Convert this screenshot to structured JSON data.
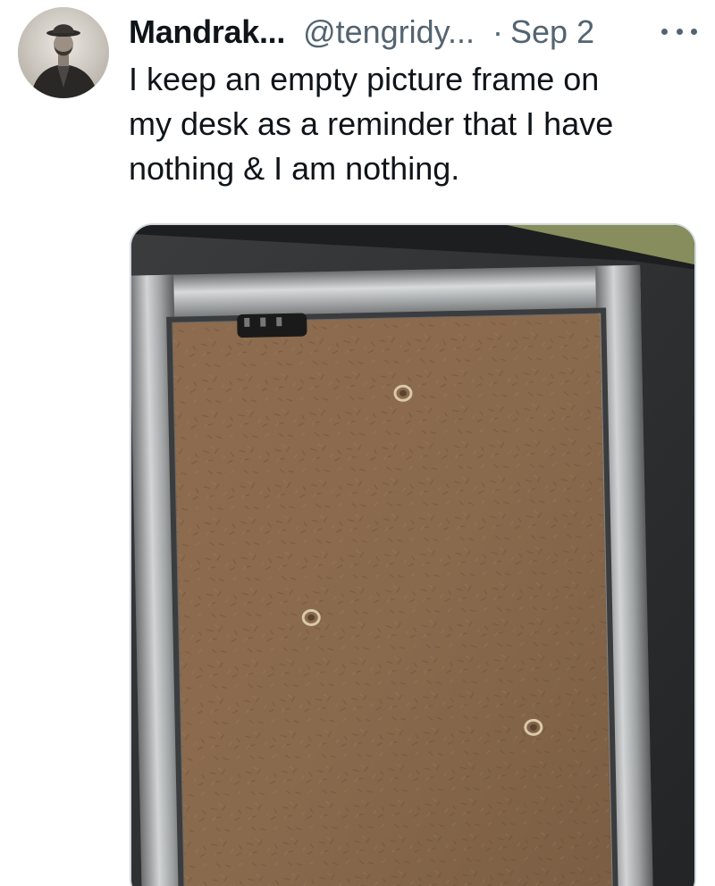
{
  "tweet": {
    "author_name": "Mandrak...",
    "author_handle": "@tengridy...",
    "separator": "·",
    "date": "Sep 2",
    "text": "I keep an empty picture frame on\nmy desk as a reminder that I have\nnothing & I am nothing.",
    "avatar_icon": "vintage-portrait-photo",
    "more_icon": "more-dots-icon",
    "media_description_icon": "empty-picture-frame-photo"
  },
  "colors": {
    "primary_text": "#0f1419",
    "secondary_text": "#536471",
    "media_border": "#cfd9de"
  }
}
